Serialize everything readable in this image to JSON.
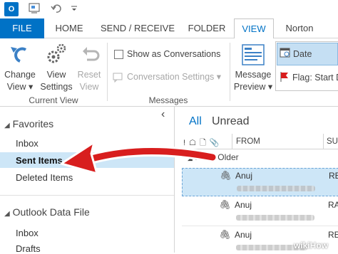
{
  "ribbon_tabs": [
    "FILE",
    "HOME",
    "SEND / RECEIVE",
    "FOLDER",
    "VIEW",
    "Norton"
  ],
  "ribbon": {
    "change_view": [
      "Change",
      "View ▾"
    ],
    "view_settings": [
      "View",
      "Settings"
    ],
    "reset_view": [
      "Reset",
      "View"
    ],
    "current_view_group": "Current View",
    "show_as_conversations": "Show as Conversations",
    "conversation_settings": "Conversation Settings ▾",
    "messages_group": "Messages",
    "message_preview": [
      "Message",
      "Preview ▾"
    ],
    "arrangement_date": "Date",
    "arrangement_flag": "Flag: Start D"
  },
  "sidebar": {
    "favorites_label": "Favorites",
    "favorites": [
      "Inbox",
      "Sent Items",
      "Deleted Items"
    ],
    "data_file_label": "Outlook Data File",
    "data_file_items": [
      "Inbox",
      "Drafts"
    ],
    "collapse_glyph": "‹"
  },
  "list": {
    "filters": [
      "All",
      "Unread"
    ],
    "columns": {
      "icons": "! ☖ 🗋 📎",
      "from": "FROM",
      "subject": "SU"
    },
    "group_label": "Date: Older",
    "rows": [
      {
        "from": "Anuj",
        "subject": "RE:"
      },
      {
        "from": "Anuj",
        "subject": "RA"
      },
      {
        "from": "Anuj",
        "subject": "RE:"
      }
    ]
  },
  "watermark": "wikiHow",
  "colors": {
    "accent": "#0072c6",
    "arrow": "#d81e1e",
    "selected": "#cde6f7"
  }
}
